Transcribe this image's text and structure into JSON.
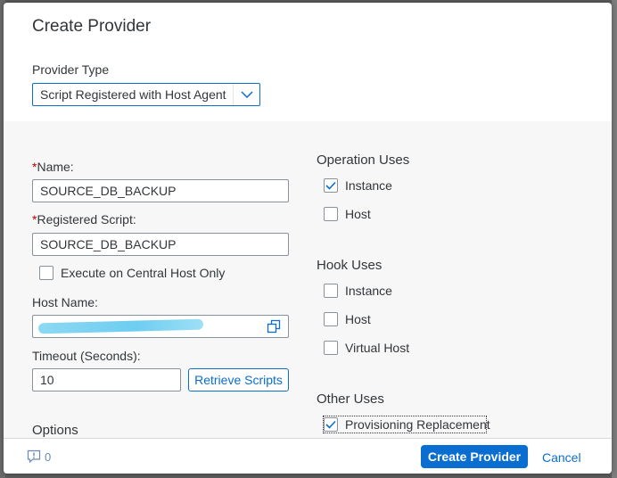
{
  "dialog": {
    "title": "Create Provider",
    "provider_type_label": "Provider Type",
    "provider_type_value": "Script Registered with Host Agent"
  },
  "form": {
    "name_label": "Name:",
    "name_value": "SOURCE_DB_BACKUP",
    "registered_script_label": "Registered Script:",
    "registered_script_value": "SOURCE_DB_BACKUP",
    "central_host_label": "Execute on Central Host Only",
    "host_name_label": "Host Name:",
    "timeout_label": "Timeout (Seconds):",
    "timeout_value": "10",
    "retrieve_scripts_label": "Retrieve Scripts",
    "options_label": "Options"
  },
  "operation_uses": {
    "title": "Operation Uses",
    "instance_label": "Instance",
    "host_label": "Host"
  },
  "hook_uses": {
    "title": "Hook Uses",
    "instance_label": "Instance",
    "host_label": "Host",
    "virtual_host_label": "Virtual Host"
  },
  "other_uses": {
    "title": "Other Uses",
    "provisioning_label": "Provisioning Replacement"
  },
  "footer": {
    "message_count": "0",
    "create_label": "Create Provider",
    "cancel_label": "Cancel"
  },
  "colors": {
    "accent": "#0a6ed1",
    "required": "#bb0000"
  }
}
